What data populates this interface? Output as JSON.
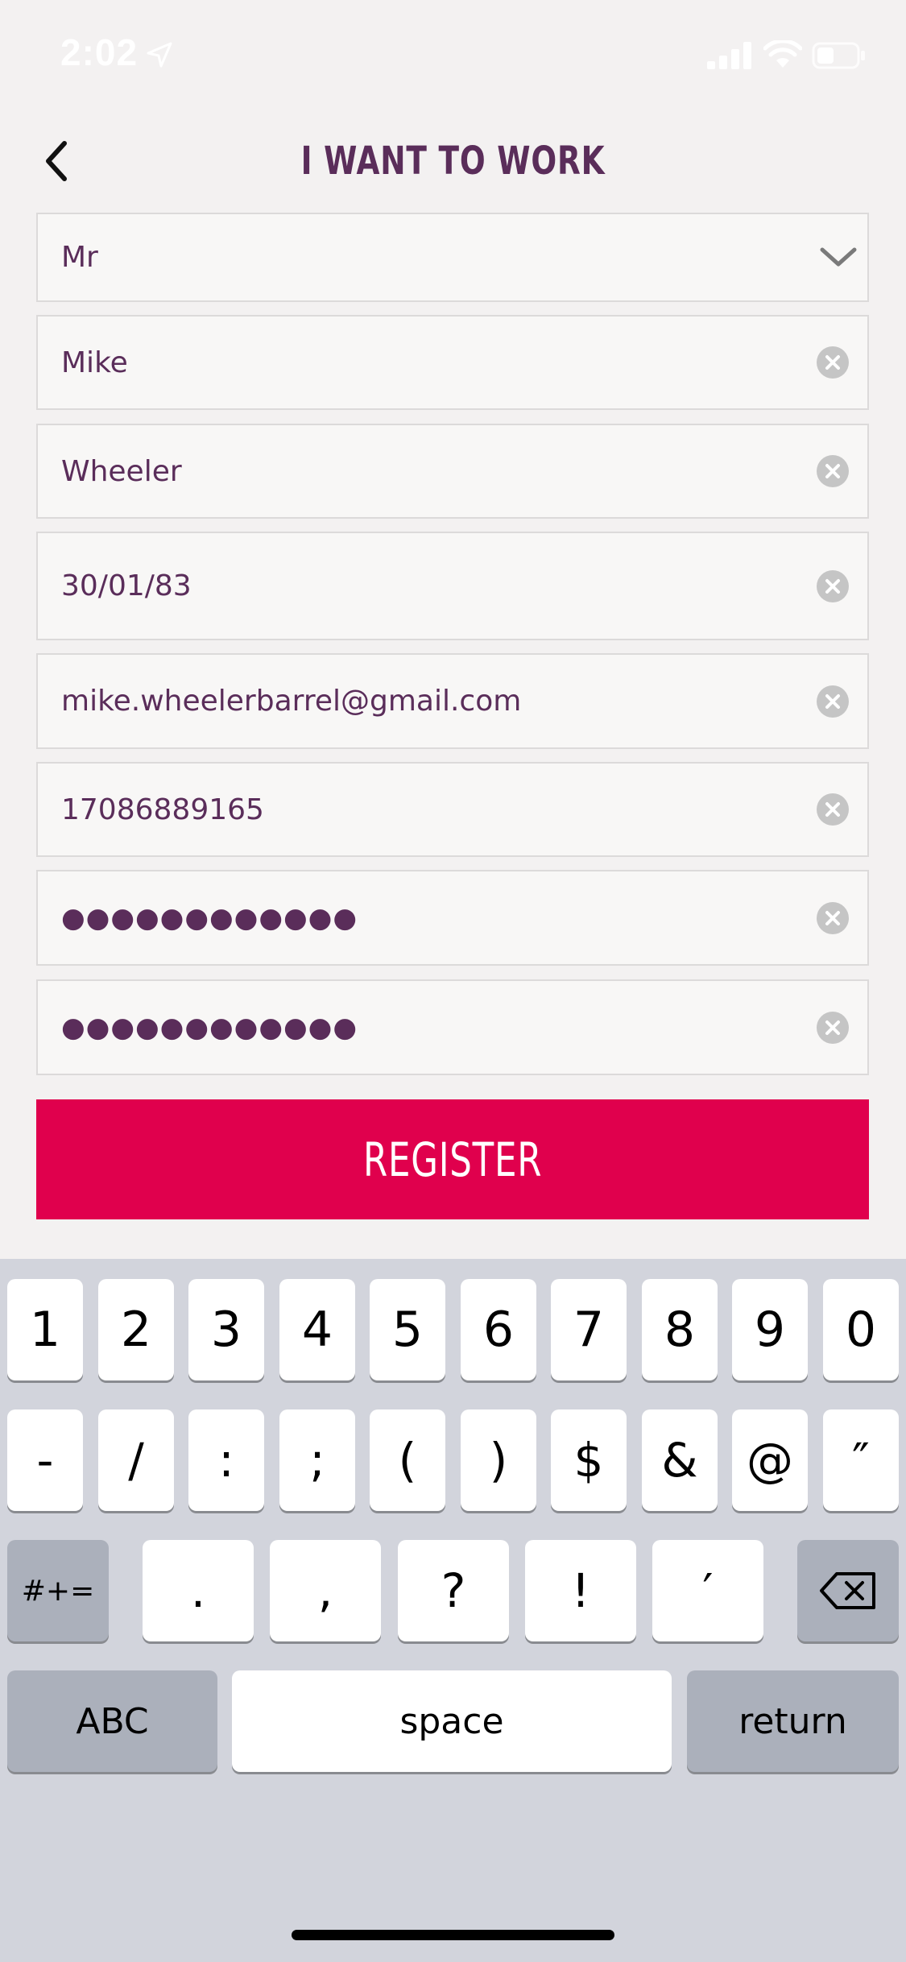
{
  "status_bar": {
    "time": "2:02"
  },
  "header": {
    "title": "I WANT TO WORK"
  },
  "form": {
    "title_select": {
      "value": "Mr"
    },
    "first_name": {
      "value": "Mike"
    },
    "last_name": {
      "value": "Wheeler"
    },
    "date_of_birth": {
      "value": "30/01/83"
    },
    "email": {
      "value": "mike.wheelerbarrel@gmail.com"
    },
    "phone": {
      "value": "17086889165"
    },
    "password": {
      "value": "●●●●●●●●●●●●"
    },
    "confirm_password": {
      "value": "●●●●●●●●●●●●"
    },
    "register_label": "REGISTER"
  },
  "keyboard": {
    "row1": [
      "1",
      "2",
      "3",
      "4",
      "5",
      "6",
      "7",
      "8",
      "9",
      "0"
    ],
    "row2": [
      "-",
      "/",
      ":",
      ";",
      "(",
      ")",
      "$",
      "&",
      "@",
      "″"
    ],
    "row3": {
      "shift_label": "#+=",
      "keys": [
        ".",
        ",",
        "?",
        "!",
        "′"
      ]
    },
    "row4": {
      "abc_label": "ABC",
      "space_label": "space",
      "return_label": "return"
    }
  },
  "colors": {
    "accent": "#e0004d",
    "title_color": "#5a2d5a",
    "background": "#f3f1f1",
    "keyboard_bg": "#d2d4dc"
  }
}
